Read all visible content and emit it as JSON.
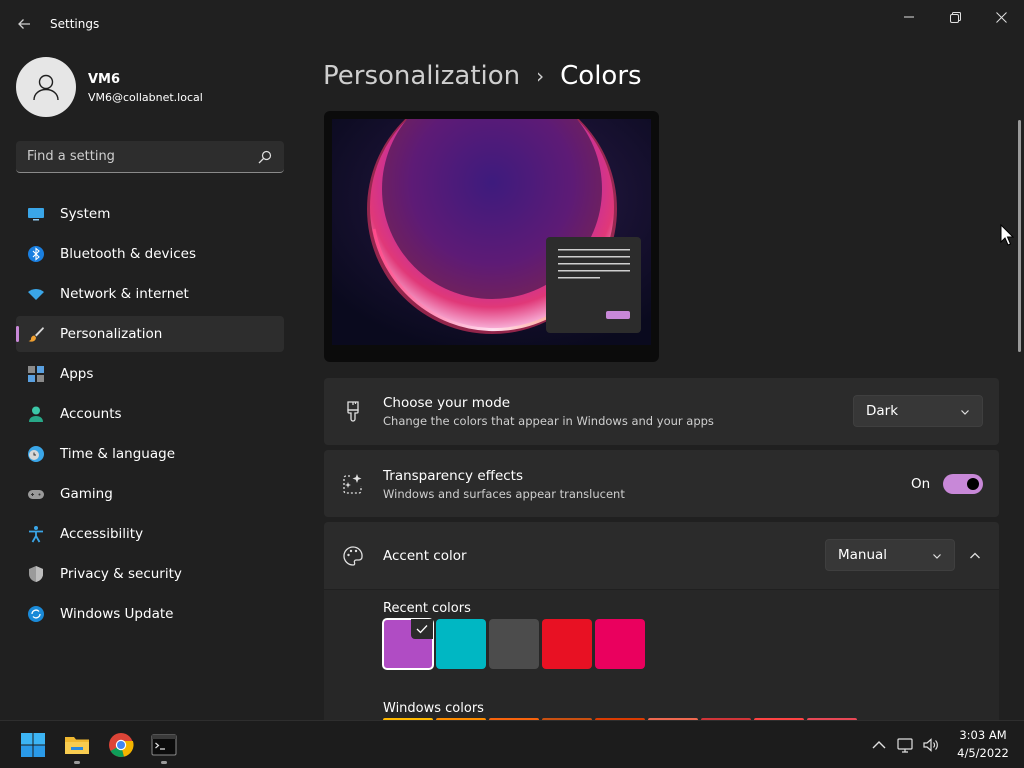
{
  "window": {
    "title": "Settings",
    "back_icon": "back-arrow-icon",
    "minimize_icon": "minimize-icon",
    "restore_icon": "restore-icon",
    "close_icon": "close-icon"
  },
  "user": {
    "name": "VM6",
    "email": "VM6@collabnet.local",
    "avatar_icon": "person-icon"
  },
  "search": {
    "placeholder": "Find a setting",
    "value": "",
    "icon": "search-icon"
  },
  "sidebar": {
    "items": [
      {
        "label": "System",
        "icon": "system-icon",
        "active": false
      },
      {
        "label": "Bluetooth & devices",
        "icon": "bluetooth-icon",
        "active": false
      },
      {
        "label": "Network & internet",
        "icon": "wifi-icon",
        "active": false
      },
      {
        "label": "Personalization",
        "icon": "brush-icon",
        "active": true
      },
      {
        "label": "Apps",
        "icon": "apps-icon",
        "active": false
      },
      {
        "label": "Accounts",
        "icon": "account-icon",
        "active": false
      },
      {
        "label": "Time & language",
        "icon": "clock-globe-icon",
        "active": false
      },
      {
        "label": "Gaming",
        "icon": "gamepad-icon",
        "active": false
      },
      {
        "label": "Accessibility",
        "icon": "accessibility-icon",
        "active": false
      },
      {
        "label": "Privacy & security",
        "icon": "shield-icon",
        "active": false
      },
      {
        "label": "Windows Update",
        "icon": "update-icon",
        "active": false
      }
    ]
  },
  "header": {
    "parent": "Personalization",
    "separator": "›",
    "current": "Colors"
  },
  "mode_card": {
    "title": "Choose your mode",
    "subtitle": "Change the colors that appear in Windows and your apps",
    "value": "Dark",
    "icon": "paint-brush-icon"
  },
  "transparency_card": {
    "title": "Transparency effects",
    "subtitle": "Windows and surfaces appear translucent",
    "toggle_label": "On",
    "toggle_on": true,
    "icon": "sparkle-window-icon"
  },
  "accent_card": {
    "title": "Accent color",
    "value": "Manual",
    "icon": "palette-icon",
    "expanded": true
  },
  "recent_colors": {
    "label": "Recent colors",
    "colors": [
      "#b04cc4",
      "#00b7c3",
      "#4c4c4c",
      "#e81123",
      "#ea005e"
    ],
    "selected_index": 0
  },
  "windows_colors": {
    "label": "Windows colors",
    "colors": [
      "#ffb900",
      "#ff8c00",
      "#f7630c",
      "#ca5010",
      "#da3b01",
      "#ef6950",
      "#d13438",
      "#ff4343",
      "#e74856"
    ]
  },
  "colors": {
    "accent": "#c888d8",
    "background": "#202020",
    "card": "#2b2b2b"
  },
  "taskbar": {
    "apps": [
      {
        "name": "start",
        "icon": "windows-start-icon"
      },
      {
        "name": "file-explorer",
        "icon": "folder-icon"
      },
      {
        "name": "chrome",
        "icon": "chrome-icon"
      },
      {
        "name": "terminal",
        "icon": "terminal-icon"
      }
    ],
    "tray": [
      "chevron-up-icon",
      "network-icon",
      "volume-icon"
    ],
    "time": "3:03 AM",
    "date": "4/5/2022"
  }
}
